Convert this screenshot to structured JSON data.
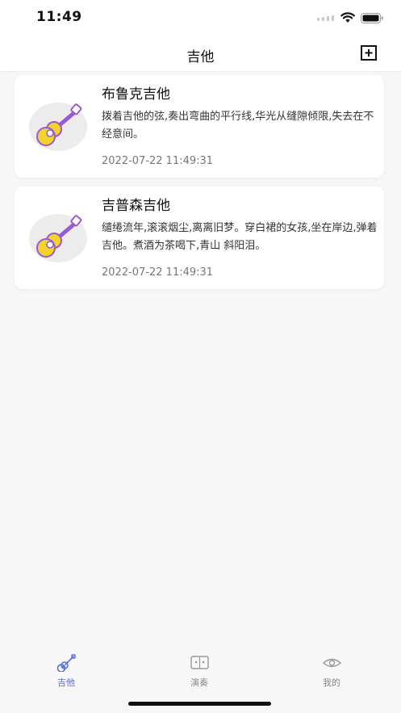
{
  "status_bar": {
    "time": "11:49"
  },
  "header": {
    "title": "吉他",
    "add_icon": "plus-square-icon"
  },
  "cards": [
    {
      "title": "布鲁克吉他",
      "description": "拨着吉他的弦,奏出弯曲的平行线,华光从缝隙倾限,失去在不经意间。",
      "time": "2022-07-22 11:49:31",
      "icon": "guitar-icon"
    },
    {
      "title": "吉普森吉他",
      "description": "缱绻流年,滚滚烟尘,离离旧梦。穿白裙的女孩,坐在岸边,弹着吉他。煮酒为茶喝下,青山 斜阳泪。",
      "time": "2022-07-22 11:49:31",
      "icon": "guitar-icon"
    }
  ],
  "tabs": [
    {
      "label": "吉他",
      "icon": "guitar-tab-icon",
      "active": true
    },
    {
      "label": "演奏",
      "icon": "book-icon",
      "active": false
    },
    {
      "label": "我的",
      "icon": "eye-icon",
      "active": false
    }
  ],
  "colors": {
    "accent": "#5a6fd9",
    "guitar_body": "#f2d32b",
    "guitar_neck": "#9b59d6"
  }
}
